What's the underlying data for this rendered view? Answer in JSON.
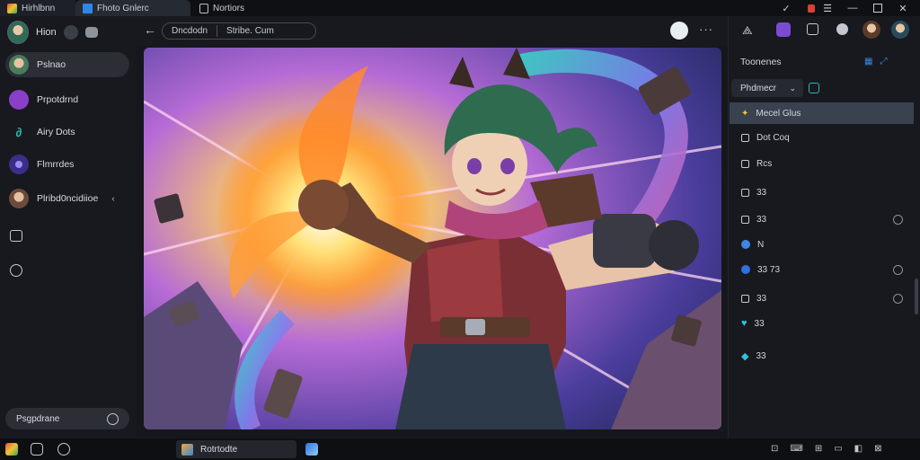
{
  "window_tabs": [
    {
      "label": "Hirhlbnn"
    },
    {
      "label": "Fhoto Gnlerc"
    },
    {
      "label": "Nortiors"
    }
  ],
  "sidebar": {
    "profile_label": "Hion",
    "items": [
      {
        "label": "Pslnao"
      },
      {
        "label": "Prpotdrnd"
      },
      {
        "label": "Airy Dots"
      },
      {
        "label": "Flmrrdes"
      },
      {
        "label": "Plribd0ncidiioe"
      }
    ],
    "bottom_label": "Psgpdrane"
  },
  "toolbar": {
    "url_left": "Dncdodn",
    "url_right": "Stribe. Cum"
  },
  "right_panel": {
    "title": "Toonenes",
    "filter_label": "Phdmecr",
    "items": [
      {
        "label": "Mecel Glus"
      },
      {
        "label": "Dot Coq"
      },
      {
        "label": "Rcs"
      },
      {
        "label": "33"
      },
      {
        "label": "33"
      },
      {
        "label": "N"
      },
      {
        "label": "33 73"
      },
      {
        "label": "33"
      },
      {
        "label": "33"
      },
      {
        "label": "33"
      }
    ]
  },
  "taskbar": {
    "app_label": "Rotrtodte"
  },
  "colors": {
    "background": "#15171c",
    "panel": "#17191e",
    "selected_row": "#3a4250",
    "accent_blue": "#2f6fe0",
    "accent_purple": "#7b4bd6",
    "accent_teal": "#2fb5b2"
  }
}
